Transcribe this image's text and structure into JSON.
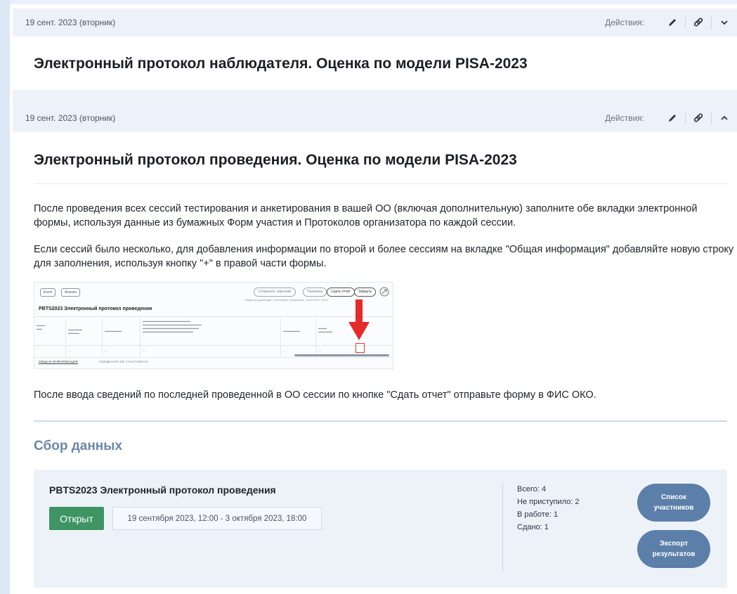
{
  "cards": [
    {
      "date": "19 сент. 2023 (вторник)",
      "actions_label": "Действия:",
      "title": "Электронный протокол наблюдателя. Оценка по модели PISA-2023",
      "chevron_icon": "chevron-down-icon"
    },
    {
      "date": "19 сент. 2023 (вторник)",
      "actions_label": "Действия:",
      "title": "Электронный протокол проведения. Оценка по модели PISA-2023",
      "chevron_icon": "chevron-up-icon",
      "paragraphs": [
        "После проведения всех сессий тестирования и анкетирования в вашей ОО (включая дополнительную) заполните обе вкладки электронной формы, используя данные из бумажных Форм участия и Протоколов организатора по каждой сессии.",
        "Если сессий было несколько, для добавления информации по второй и более сессиям на вкладке \"Общая информация\" добавляйте новую строку для заполнения, используя кнопку \"+\" в правой части формы.",
        "После ввода сведений по последней проведенной в ОО сессии по кнопке \"Сдать отчет\" отправьте форму в ФИС ОКО."
      ],
      "preview": {
        "buttons": [
          "Excel",
          "Анализ"
        ],
        "pills": [
          "Сохранить черновик",
          "Проверка",
          "Сдать отчет",
          "Закрыть"
        ],
        "subtitle": "Редактор дашборда • Последнее сохранение: 18.09.2023 13:31",
        "title": "PBTS2023 Электронный протокол проведения",
        "tabs": [
          "ОБЩАЯ ИНФОРМАЦИЯ",
          "СВЕДЕНИЯ ОБ УЧАСТНИКАХ"
        ]
      }
    }
  ],
  "section_title": "Сбор данных",
  "collect": {
    "title": "PBTS2023 Электронный протокол проведения",
    "status": "Открыт",
    "dates": "19 сентября 2023, 12:00 - 3 октября 2023, 18:00",
    "stats": [
      "Всего: 4",
      "Не приступило: 2",
      "В работе: 1",
      "Сдано: 1"
    ],
    "buttons": {
      "list": [
        "Список",
        "участников"
      ],
      "export": [
        "Экспорт",
        "результатов"
      ]
    }
  },
  "colors": {
    "accent_green": "#3f9464",
    "pill_blue": "#5b7fa8",
    "header_bg": "#edf2fa",
    "section_title": "#6b87a8"
  }
}
